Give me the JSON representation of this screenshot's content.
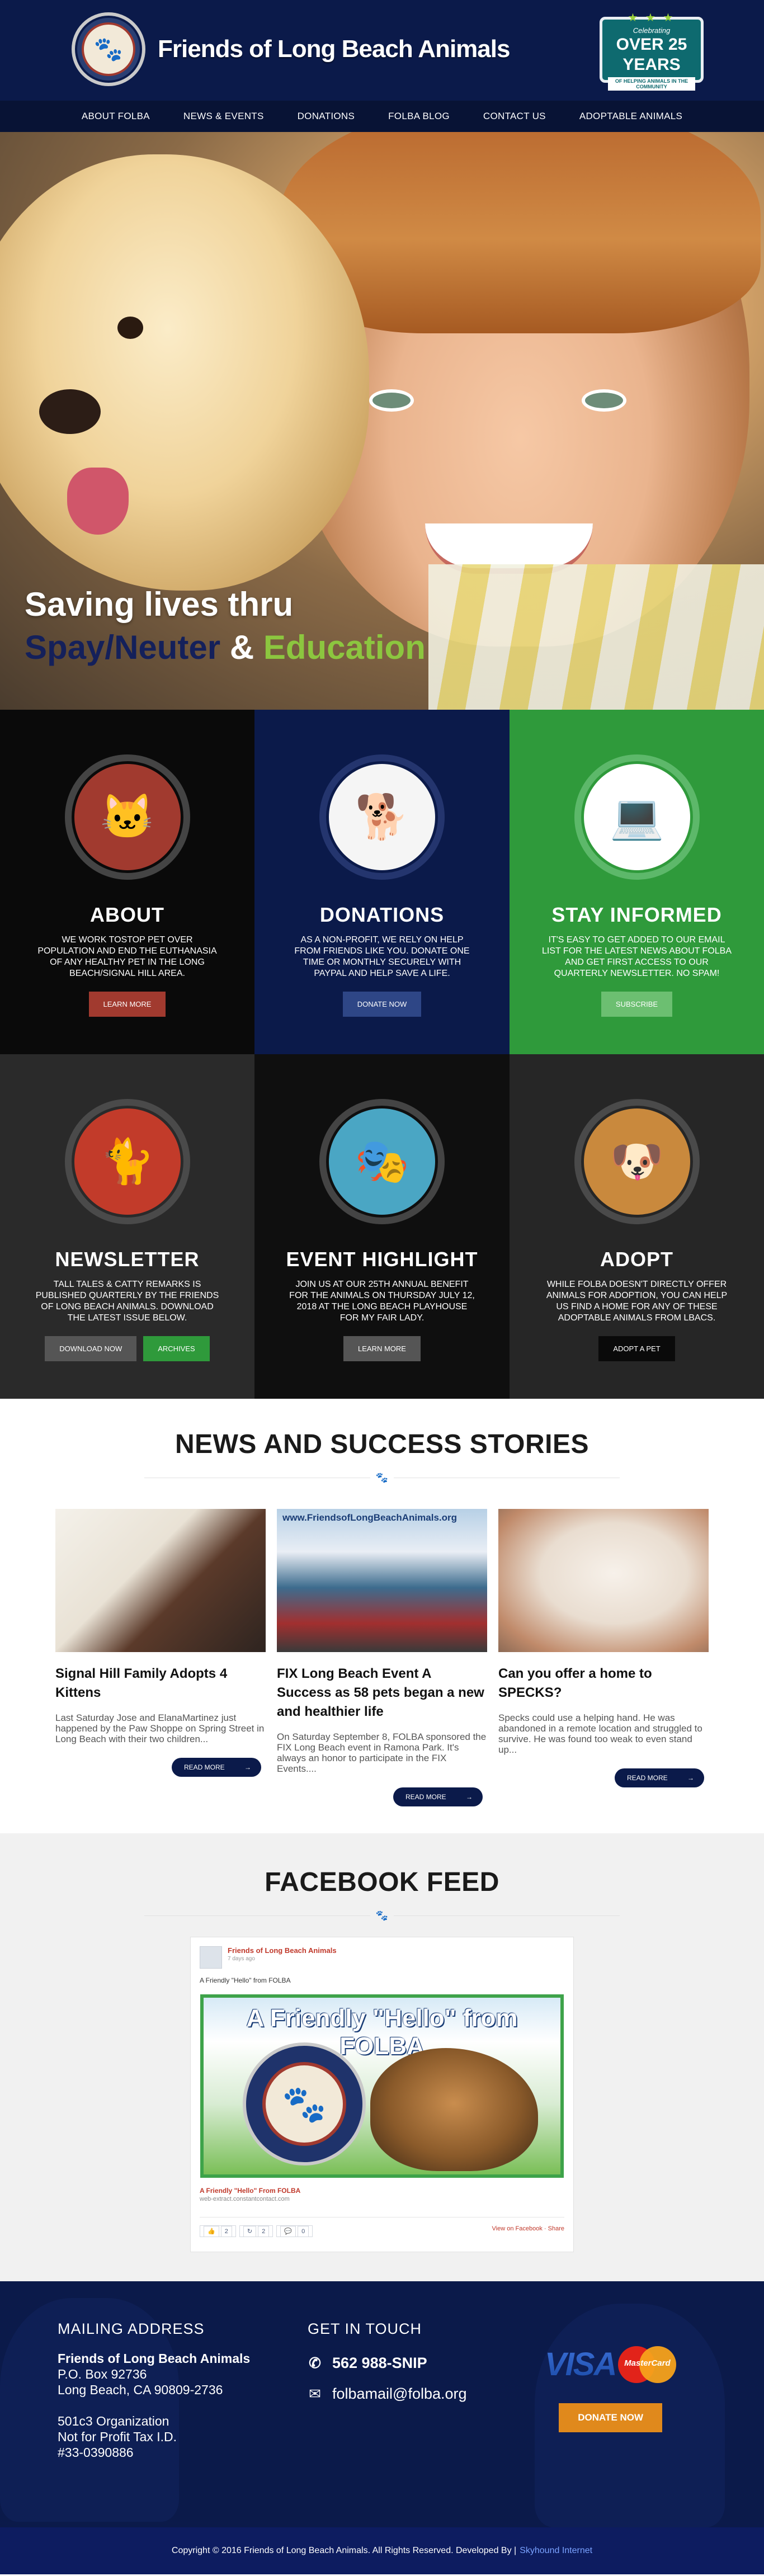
{
  "header": {
    "site_name": "Friends of Long Beach Animals",
    "badge": {
      "top": "Celebrating",
      "big": "OVER 25 YEARS",
      "bottom": "OF HELPING ANIMALS IN THE COMMUNITY"
    },
    "nav": [
      "ABOUT FOLBA",
      "NEWS & EVENTS",
      "DONATIONS",
      "FOLBA BLOG",
      "CONTACT US",
      "ADOPTABLE ANIMALS"
    ]
  },
  "hero": {
    "line1": "Saving lives thru",
    "line2_a": "Spay/Neuter",
    "line2_b": "&",
    "line2_c": "Education"
  },
  "tiles": [
    {
      "title": "ABOUT",
      "text": "WE WORK TOSTOP PET OVER POPULATION AND END THE EUTHANASIA OF ANY HEALTHY PET IN THE LONG BEACH/SIGNAL HILL AREA.",
      "button": "LEARN MORE"
    },
    {
      "title": "DONATIONS",
      "text": "AS A NON-PROFIT, WE RELY ON HELP FROM FRIENDS LIKE YOU.  DONATE ONE TIME OR MONTHLY SECURELY WITH PAYPAL AND HELP SAVE A LIFE.",
      "button": "DONATE NOW"
    },
    {
      "title": "STAY INFORMED",
      "text": "IT'S EASY TO GET ADDED TO OUR EMAIL LIST FOR THE LATEST NEWS ABOUT FOLBA AND GET FIRST ACCESS TO OUR QUARTERLY NEWSLETTER.  NO SPAM!",
      "button": "SUBSCRIBE"
    },
    {
      "title": "NEWSLETTER",
      "text": "TALL TALES & CATTY REMARKS IS PUBLISHED QUARTERLY BY THE FRIENDS OF LONG BEACH ANIMALS.  DOWNLOAD THE LATEST ISSUE BELOW.",
      "button": "DOWNLOAD NOW",
      "button2": "ARCHIVES"
    },
    {
      "title": "EVENT HIGHLIGHT",
      "text": "JOIN US AT OUR 25TH ANNUAL BENEFIT FOR THE ANIMALS ON THURSDAY JULY 12, 2018 AT THE LONG BEACH PLAYHOUSE FOR MY FAIR LADY.",
      "button": "LEARN MORE"
    },
    {
      "title": "ADOPT",
      "text": "WHILE FOLBA DOESN'T DIRECTLY OFFER ANIMALS FOR ADOPTION, YOU CAN HELP US FIND A HOME FOR ANY OF THESE ADOPTABLE ANIMALS FROM LBACS.",
      "button": "ADOPT A PET"
    }
  ],
  "news": {
    "title": "NEWS AND SUCCESS STORIES",
    "items": [
      {
        "title": "Signal Hill Family Adopts 4 Kittens",
        "excerpt": "Last Saturday Jose and ElanaMartinez just happened by the Paw Shoppe on Spring Street in Long     Beach with their two children...",
        "button": "READ MORE"
      },
      {
        "title": "FIX Long Beach Event A Success as 58 pets began a new and healthier life",
        "excerpt": "On Saturday September 8, FOLBA sponsored the FIX Long Beach event in Ramona Park.  It's   always an honor to participate in the FIX Events....",
        "button": "READ MORE"
      },
      {
        "title": "Can you offer a home to SPECKS?",
        "excerpt": "Specks could use a helping hand.  He was abandoned in a remote location and struggled to     survive.  He was found too weak to even stand up...",
        "button": "READ MORE"
      }
    ],
    "banner_text": "www.FriendsofLongBeachAnimals.org"
  },
  "facebook": {
    "title": "FACEBOOK FEED",
    "page_name": "Friends of Long Beach Animals",
    "time": "7 days ago",
    "message": "A Friendly \"Hello\" from FOLBA",
    "image_headline": "A Friendly \"Hello\" from FOLBA",
    "link_title": "A Friendly \"Hello\" From FOLBA",
    "link_domain": "web-extract.constantcontact.com",
    "stats": {
      "likes": "2",
      "shares": "2",
      "comments": "0"
    },
    "links": {
      "view": "View on Facebook",
      "sep": "·",
      "share": "Share"
    }
  },
  "footer": {
    "mailing_heading": "MAILING ADDRESS",
    "org": "Friends of Long Beach Animals",
    "address1": "P.O. Box 92736",
    "address2": "Long Beach, CA 90809-2736",
    "org_type": "501c3 Organization",
    "tax_label": "Not for Profit Tax I.D.",
    "tax_id": "#33-0390886",
    "contact_heading": "GET IN TOUCH",
    "phone": "562 988-SNIP",
    "email": "folbamail@folba.org",
    "card1": "VISA",
    "card2": "MasterCard",
    "donate_button": "DONATE NOW"
  },
  "copyright": {
    "text": "Copyright © 2016 Friends of Long Beach Animals. All Rights Reserved. Developed By |",
    "developer": "Skyhound Internet"
  }
}
